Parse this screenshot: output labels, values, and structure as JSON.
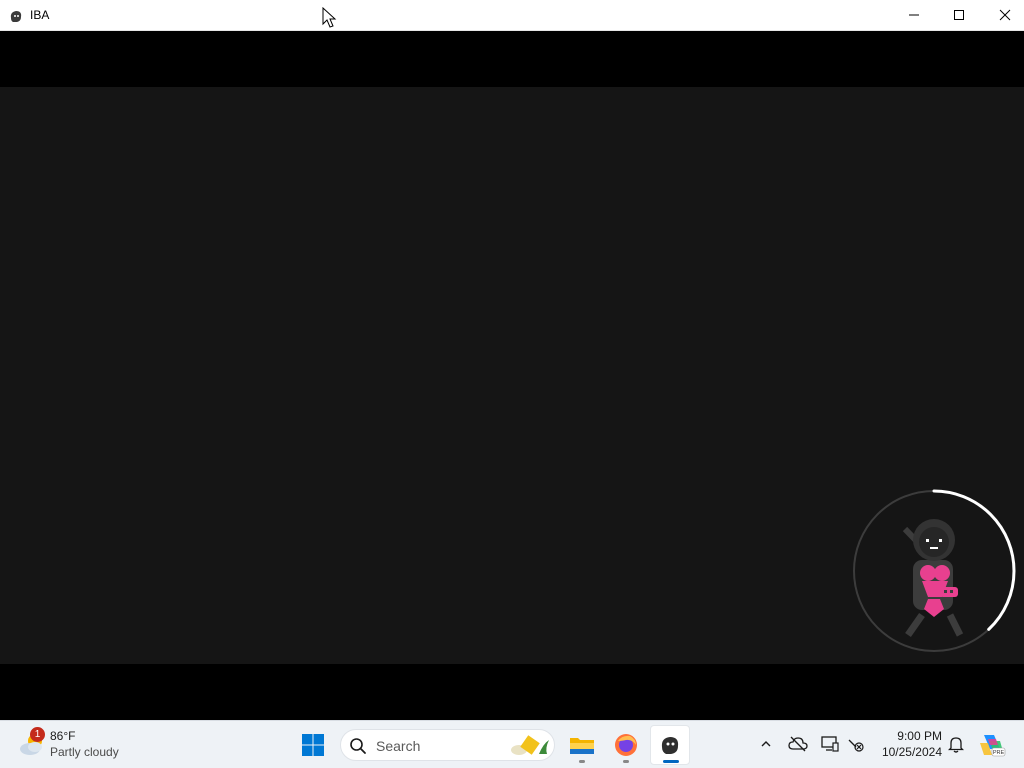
{
  "window": {
    "title": "IBA",
    "app_icon": "iba-ghost-icon",
    "controls": [
      "minimize-icon",
      "maximize-icon",
      "close-icon"
    ]
  },
  "game": {
    "background_color": "#151515",
    "letterbox_color": "#000000",
    "loading_indicator": {
      "character": "pixel-character-with-pink-outfit",
      "progress_fraction": 0.38,
      "ring_color": "#ffffff"
    }
  },
  "taskbar": {
    "weather": {
      "badge": "1",
      "temperature": "86°F",
      "condition": "Partly cloudy"
    },
    "search": {
      "placeholder": "Search"
    },
    "pinned_apps": [
      "start-windows-icon",
      "file-explorer-icon",
      "firefox-icon",
      "iba-app-icon"
    ],
    "tray": [
      "chevron-up-icon",
      "cloud-off-icon",
      "display-icon",
      "network-off-icon",
      "bell-icon",
      "copilot-icon"
    ],
    "clock": {
      "time": "9:00 PM",
      "date": "10/25/2024"
    },
    "accent_color": "#0067c0"
  }
}
